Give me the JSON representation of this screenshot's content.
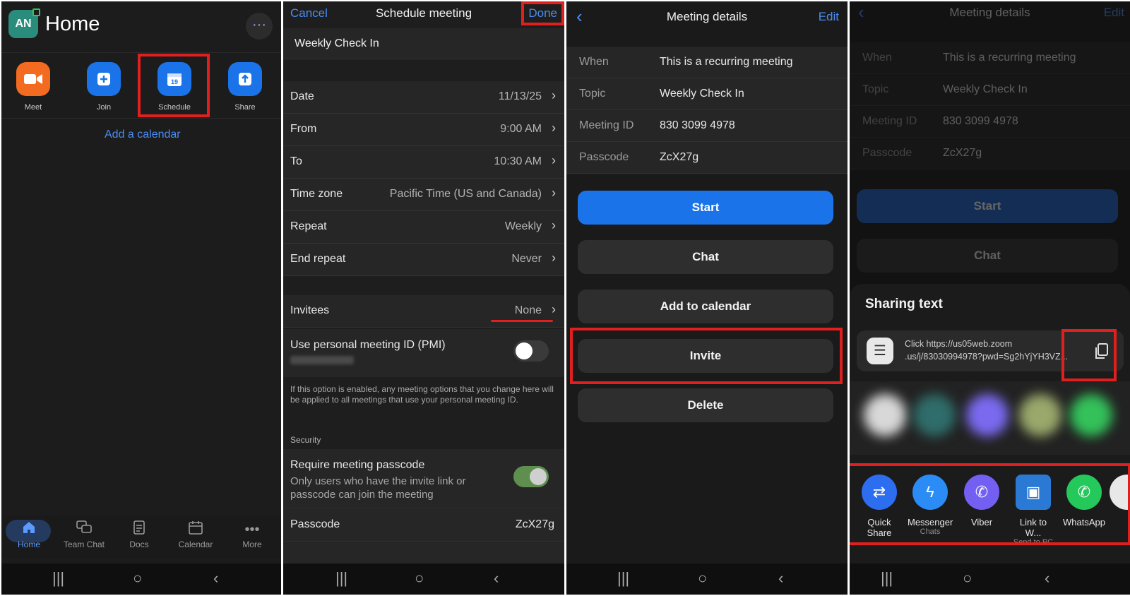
{
  "panel1": {
    "avatar": "AN",
    "title": "Home",
    "more": "···",
    "actions": [
      {
        "label": "Meet",
        "icon": "video-camera-icon",
        "color": "#f26b21"
      },
      {
        "label": "Join",
        "icon": "plus-icon",
        "color": "#1a73e8"
      },
      {
        "label": "Schedule",
        "icon": "calendar-icon",
        "color": "#1a73e8",
        "day": "19"
      },
      {
        "label": "Share",
        "icon": "share-up-arrow-icon",
        "color": "#1a73e8"
      }
    ],
    "add_calendar": "Add a calendar",
    "tabs": [
      "Home",
      "Team Chat",
      "Docs",
      "Calendar",
      "More"
    ]
  },
  "panel2": {
    "cancel": "Cancel",
    "title": "Schedule meeting",
    "done": "Done",
    "meeting_name": "Weekly Check In",
    "rows": [
      {
        "label": "Date",
        "value": "11/13/25"
      },
      {
        "label": "From",
        "value": "9:00 AM"
      },
      {
        "label": "To",
        "value": "10:30 AM"
      },
      {
        "label": "Time zone",
        "value": "Pacific Time (US and Canada)"
      },
      {
        "label": "Repeat",
        "value": "Weekly"
      },
      {
        "label": "End repeat",
        "value": "Never"
      }
    ],
    "invitees_label": "Invitees",
    "invitees_value": "None",
    "pmi_label": "Use personal meeting ID (PMI)",
    "pmi_note": "If this option is enabled, any meeting options that you change here will be applied to all meetings that use your personal meeting ID.",
    "security_header": "Security",
    "passcode_req_label": "Require meeting passcode",
    "passcode_req_desc": "Only users who have the invite link or passcode can join the meeting",
    "passcode_label": "Passcode",
    "passcode_value": "ZcX27g"
  },
  "panel3": {
    "title": "Meeting details",
    "edit": "Edit",
    "details": [
      {
        "key": "When",
        "value": "This is a recurring meeting"
      },
      {
        "key": "Topic",
        "value": "Weekly Check In"
      },
      {
        "key": "Meeting ID",
        "value": "830 3099 4978"
      },
      {
        "key": "Passcode",
        "value": "ZcX27g"
      }
    ],
    "buttons": [
      "Start",
      "Chat",
      "Add to calendar",
      "Invite",
      "Delete"
    ]
  },
  "panel4": {
    "title": "Meeting details",
    "edit": "Edit",
    "details": [
      {
        "key": "When",
        "value": "This is a recurring meeting"
      },
      {
        "key": "Topic",
        "value": "Weekly Check In"
      },
      {
        "key": "Meeting ID",
        "value": "830 3099 4978"
      },
      {
        "key": "Passcode",
        "value": "ZcX27g"
      }
    ],
    "start": "Start",
    "chat": "Chat",
    "sharing_title": "Sharing text",
    "share_line1": "Click https://us05web.zoom",
    "share_line2": ".us/j/83030994978?pwd=Sg2hYjYH3VZ...",
    "apps": [
      {
        "name": "Quick Share",
        "sub": "",
        "color": "#2d6df0",
        "icon": "quick-share-icon"
      },
      {
        "name": "Messenger",
        "sub": "Chats",
        "color": "#2b8cf6",
        "icon": "messenger-icon"
      },
      {
        "name": "Viber",
        "sub": "",
        "color": "#7360f2",
        "icon": "viber-icon"
      },
      {
        "name": "Link to W...",
        "sub": "Send to PC",
        "color": "#2a7ad5",
        "icon": "link-to-windows-icon"
      },
      {
        "name": "WhatsApp",
        "sub": "",
        "color": "#25c85a",
        "icon": "whatsapp-icon"
      }
    ]
  }
}
